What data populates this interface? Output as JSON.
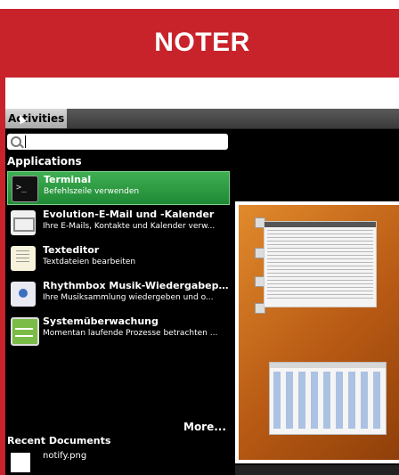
{
  "banner": {
    "title": "NOTER"
  },
  "topbar": {
    "activities_label": "Activities"
  },
  "search": {
    "value": ""
  },
  "applications": {
    "title": "Applications",
    "items": [
      {
        "name": "Terminal",
        "desc": "Befehlszeile verwenden",
        "icon": "terminal-icon"
      },
      {
        "name": "Evolution-E-Mail und -Kalender",
        "desc": "Ihre E-Mails, Kontakte und Kalender verw...",
        "icon": "mail-icon"
      },
      {
        "name": "Texteditor",
        "desc": "Textdateien bearbeiten",
        "icon": "text-editor-icon"
      },
      {
        "name": "Rhythmbox Musik-Wiedergabepro...",
        "desc": "Ihre Musiksammlung wiedergeben und o...",
        "icon": "music-player-icon"
      },
      {
        "name": "Systemüberwachung",
        "desc": "Momentan laufende Prozesse betrachten ...",
        "icon": "system-monitor-icon"
      }
    ],
    "more_label": "More..."
  },
  "recent": {
    "title": "Recent Documents",
    "items": [
      {
        "name": "notify.png"
      }
    ]
  },
  "colors": {
    "banner": "#c8232b",
    "selected": "#2d9a43"
  }
}
